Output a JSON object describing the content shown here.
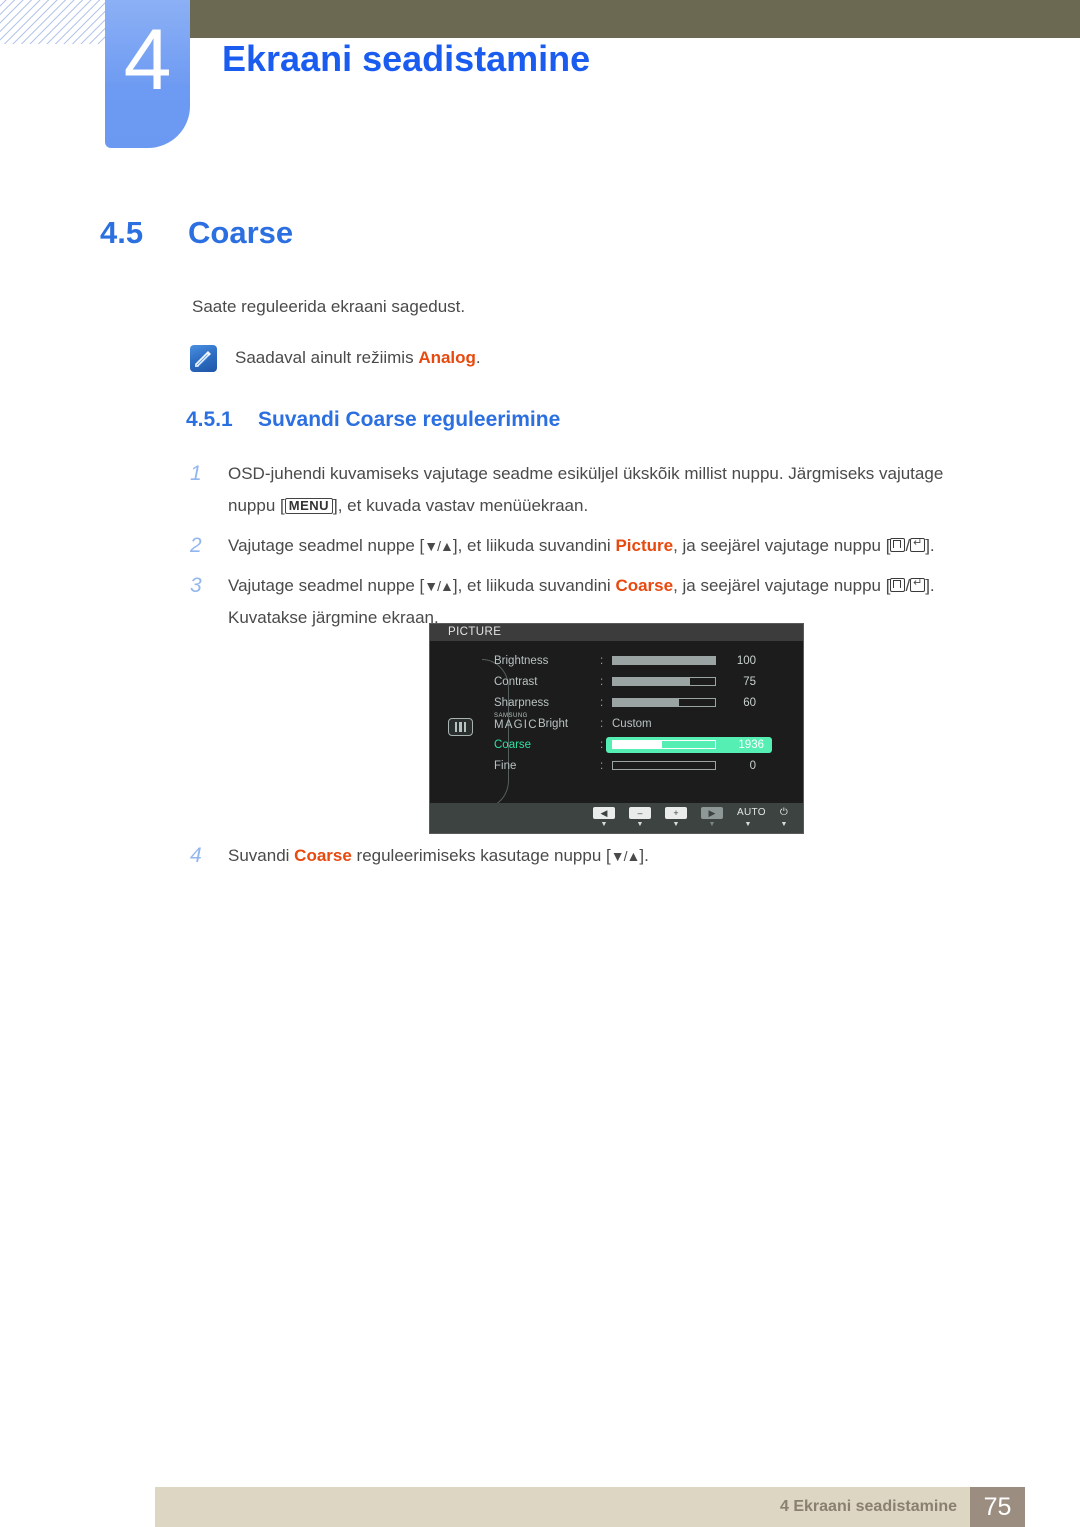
{
  "chapter": {
    "number": "4",
    "title": "Ekraani seadistamine"
  },
  "section": {
    "number": "4.5",
    "title": "Coarse"
  },
  "intro": "Saate reguleerida ekraani sagedust.",
  "note": {
    "icon": "note-pen-icon",
    "text_before": "Saadaval ainult režiimis ",
    "highlight": "Analog",
    "text_after": "."
  },
  "subsection": {
    "number": "4.5.1",
    "title": "Suvandi Coarse reguleerimine"
  },
  "steps": [
    {
      "num": "1",
      "part1": "OSD-juhendi kuvamiseks vajutage seadme esiküljel ükskõik millist nuppu. Järgmiseks vajutage nuppu [",
      "key": "MENU",
      "part2": "], et kuvada vastav menüüekraan."
    },
    {
      "num": "2",
      "part1": "Vajutage seadmel nuppe [",
      "glyph1": "▼/▲",
      "part2": "], et liikuda suvandini ",
      "highlight": "Picture",
      "part3": ", ja seejärel vajutage nuppu [",
      "part4": "]."
    },
    {
      "num": "3",
      "part1": "Vajutage seadmel nuppe [",
      "glyph1": "▼/▲",
      "part2": "], et liikuda suvandini ",
      "highlight": "Coarse",
      "part3": ", ja seejärel vajutage nuppu [",
      "part4": "]. Kuvatakse järgmine ekraan."
    },
    {
      "num": "4",
      "part1": "Suvandi ",
      "highlight": "Coarse",
      "part2": " reguleerimiseks kasutage nuppu [",
      "glyph1": "▼/▲",
      "part3": "]."
    }
  ],
  "osd": {
    "title": "PICTURE",
    "menu_icon": "picture-bars-icon",
    "rows": [
      {
        "label": "Brightness",
        "colon": ":",
        "value": "100",
        "fill_pct": 100,
        "type": "bar",
        "selected": false
      },
      {
        "label": "Contrast",
        "colon": ":",
        "value": "75",
        "fill_pct": 75,
        "type": "bar",
        "selected": false
      },
      {
        "label": "Sharpness",
        "colon": ":",
        "value": "60",
        "fill_pct": 65,
        "type": "bar",
        "selected": false
      },
      {
        "label": "MAGIC Bright",
        "label_sup": "SAMSUNG",
        "label_main": "MAGIC",
        "label_suffix": "Bright",
        "colon": ":",
        "value": "Custom",
        "type": "text",
        "selected": false
      },
      {
        "label": "Coarse",
        "colon": ":",
        "value": "1936",
        "fill_pct": 48,
        "type": "bar",
        "selected": true
      },
      {
        "label": "Fine",
        "colon": ":",
        "value": "0",
        "fill_pct": 0,
        "type": "bar",
        "selected": false
      }
    ],
    "buttons": [
      {
        "name": "left-arrow-button",
        "glyph": "◀",
        "dim": false,
        "caret": "▼",
        "caret_dim": false
      },
      {
        "name": "minus-button",
        "glyph": "–",
        "dim": false,
        "caret": "▼",
        "caret_dim": false
      },
      {
        "name": "plus-button",
        "glyph": "+",
        "dim": false,
        "caret": "▼",
        "caret_dim": false
      },
      {
        "name": "right-arrow-button",
        "glyph": "▶",
        "dim": true,
        "caret": "▼",
        "caret_dim": true
      },
      {
        "name": "auto-button",
        "glyph": "AUTO",
        "dim": false,
        "caret": "▼",
        "caret_dim": false,
        "text": true
      },
      {
        "name": "power-button",
        "glyph": "⏻",
        "dim": false,
        "caret": "▼",
        "caret_dim": false,
        "text": true
      }
    ]
  },
  "footer": {
    "text": "4 Ekraani seadistamine",
    "page": "75"
  },
  "colors": {
    "heading_blue": "#2b6fe0",
    "title_blue": "#1b5cf0",
    "highlight_orange": "#e8490f",
    "topbar_olive": "#6b6952",
    "tab_blue": "#6d9af2",
    "footer_beige": "#dcd6c3",
    "footer_page_brown": "#9b8e80",
    "osd_selected_green": "#55efb4"
  }
}
